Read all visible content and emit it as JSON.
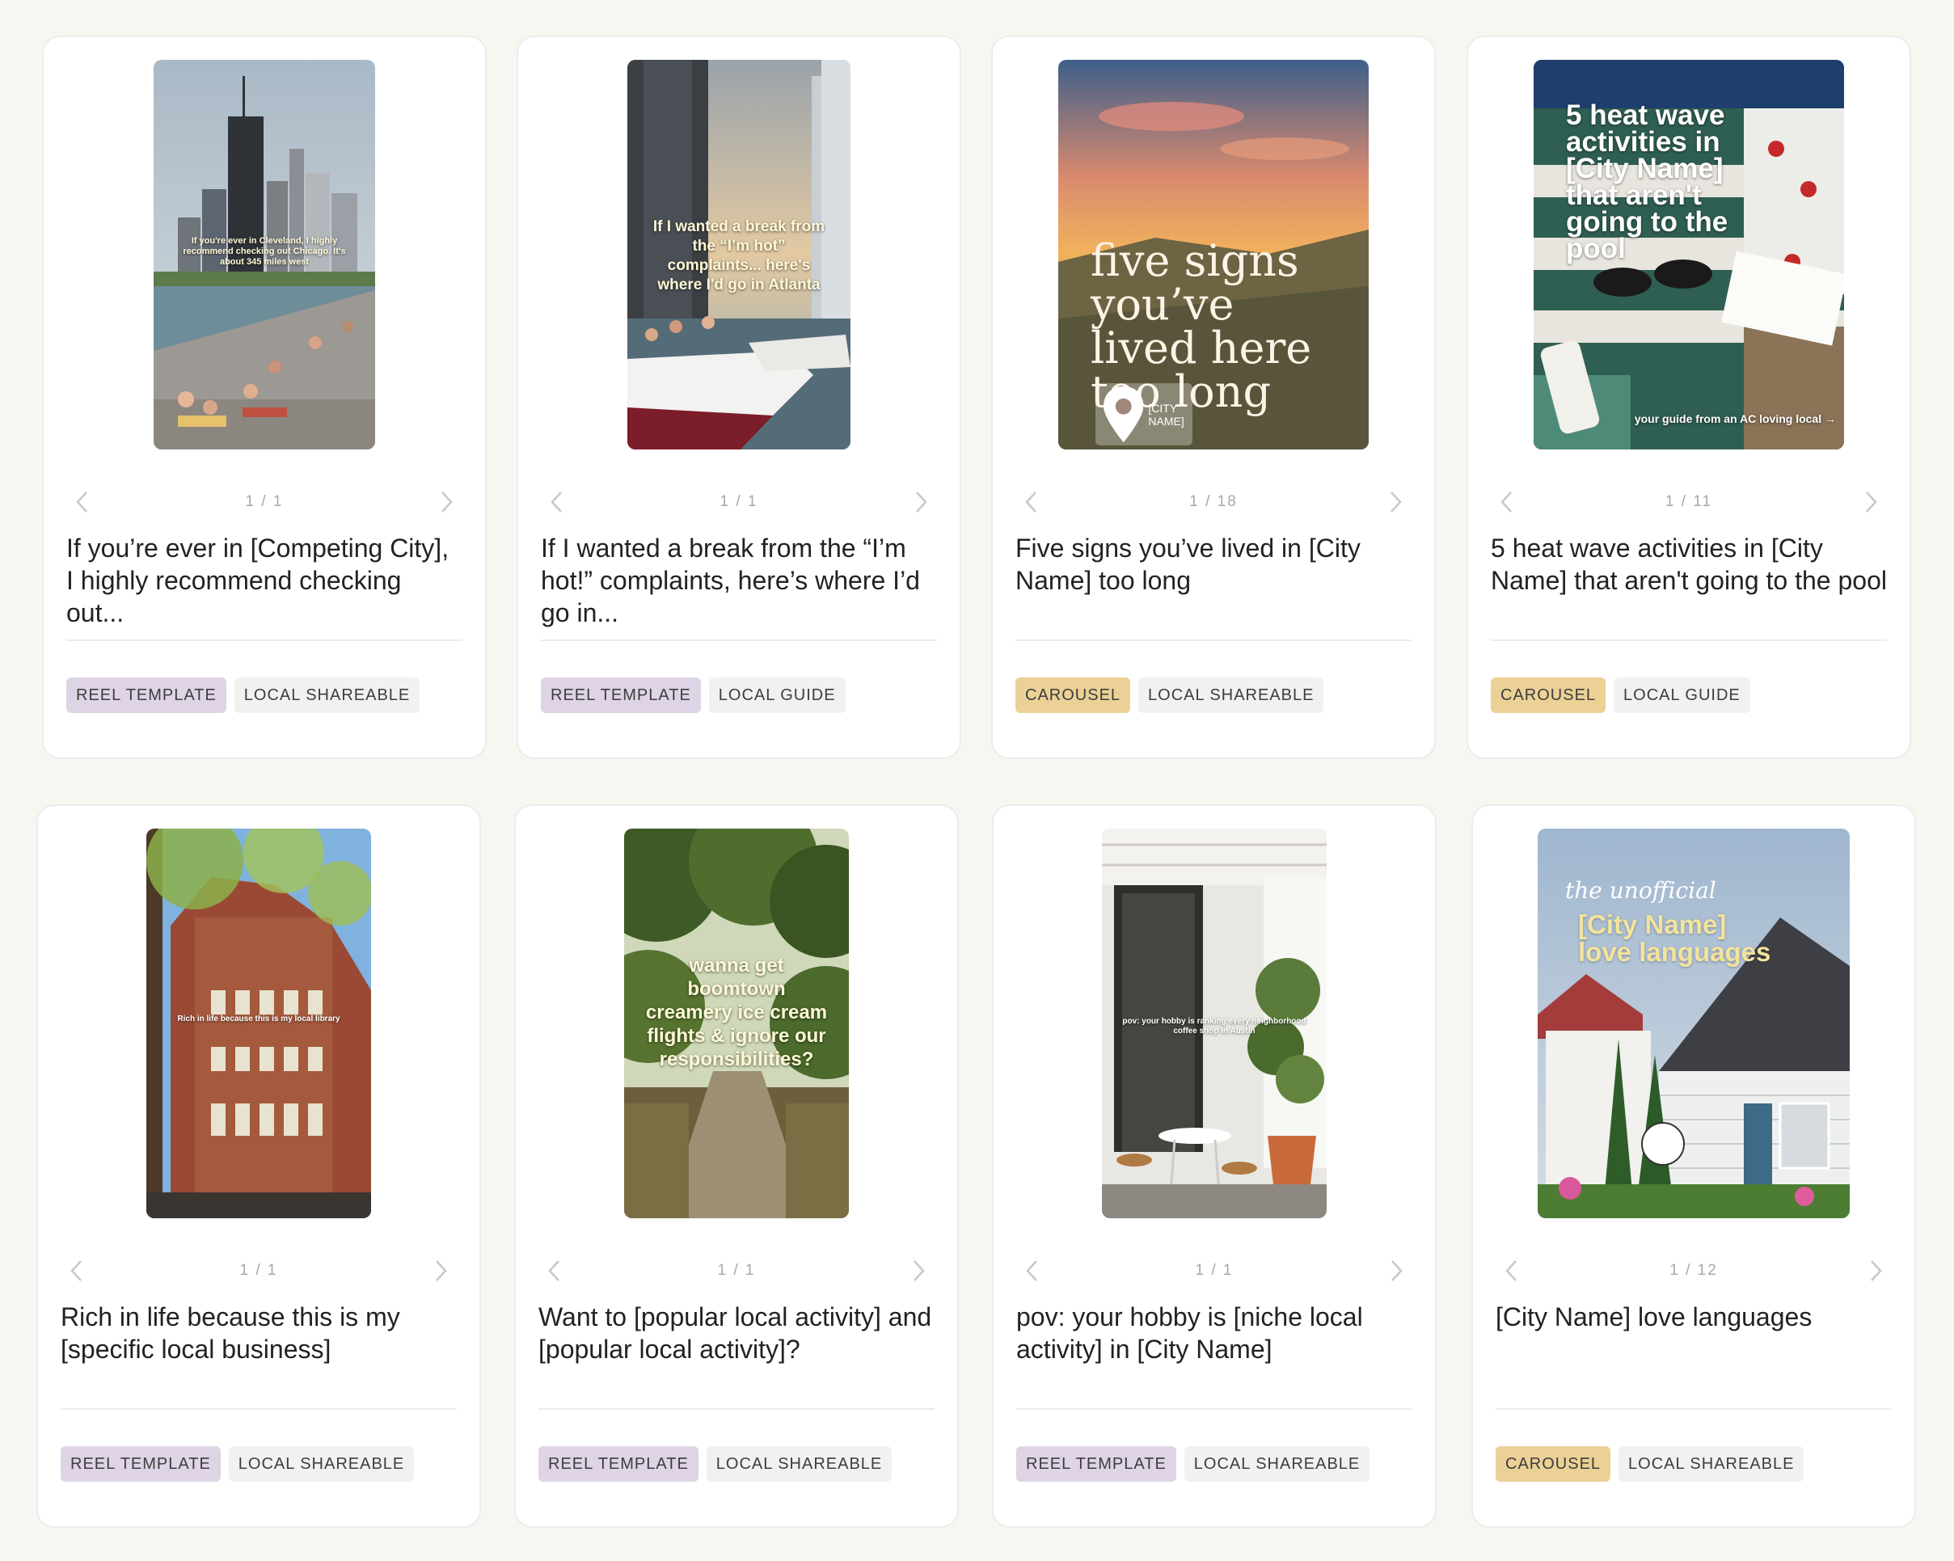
{
  "colors": {
    "page_bg": "#f7f7f2",
    "card_bg": "#ffffff",
    "tag_reel": "#dfd3e6",
    "tag_carousel": "#ecd196",
    "tag_neutral": "#f1f1ef"
  },
  "cards": [
    {
      "overlay": "If you're ever in Cleveland, I highly recommend checking out Chicago. It's about 345 miles west",
      "page": "1 / 1",
      "title": "If you’re ever in [Competing City], I highly recommend checking out...",
      "type_tag": "REEL TEMPLATE",
      "category_tag": "LOCAL SHAREABLE"
    },
    {
      "overlay": "If I wanted a break from the “I’m hot” complaints... here's where I'd go in Atlanta",
      "page": "1 / 1",
      "title": "If I wanted a break from the “I’m hot!” complaints, here’s where I’d go in...",
      "type_tag": "REEL TEMPLATE",
      "category_tag": "LOCAL GUIDE"
    },
    {
      "overlay": "five signs you’ve lived here too long",
      "overlay_chip": "[CITY NAME]",
      "page": "1 / 18",
      "title": "Five signs you’ve lived in [City Name] too long",
      "type_tag": "CAROUSEL",
      "category_tag": "LOCAL SHAREABLE"
    },
    {
      "overlay": "5 heat wave activities in [City Name] that aren't going to the pool",
      "overlay_footer": "your guide from an AC loving local →",
      "page": "1 / 11",
      "title": "5 heat wave activities in [City Name] that aren't going to the pool",
      "type_tag": "CAROUSEL",
      "category_tag": "LOCAL GUIDE"
    },
    {
      "overlay": "Rich in life because this is my local library",
      "page": "1 / 1",
      "title": "Rich in life because this is my [specific local business]",
      "type_tag": "REEL TEMPLATE",
      "category_tag": "LOCAL SHAREABLE"
    },
    {
      "overlay": "wanna get boomtown creamery ice cream flights & ignore our responsibilities?",
      "page": "1 / 1",
      "title": "Want to [popular local activity] and [popular local activity]?",
      "type_tag": "REEL TEMPLATE",
      "category_tag": "LOCAL SHAREABLE"
    },
    {
      "overlay": "pov: your hobby is ranking every neighborhood coffee shop in Austin",
      "page": "1 / 1",
      "title": "pov: your hobby is [niche local activity] in [City Name]",
      "type_tag": "REEL TEMPLATE",
      "category_tag": "LOCAL SHAREABLE"
    },
    {
      "overlay_script": "the unofficial",
      "overlay": "[City Name] love languages",
      "page": "1 / 12",
      "title": "[City Name] love languages",
      "type_tag": "CAROUSEL",
      "category_tag": "LOCAL SHAREABLE"
    }
  ]
}
